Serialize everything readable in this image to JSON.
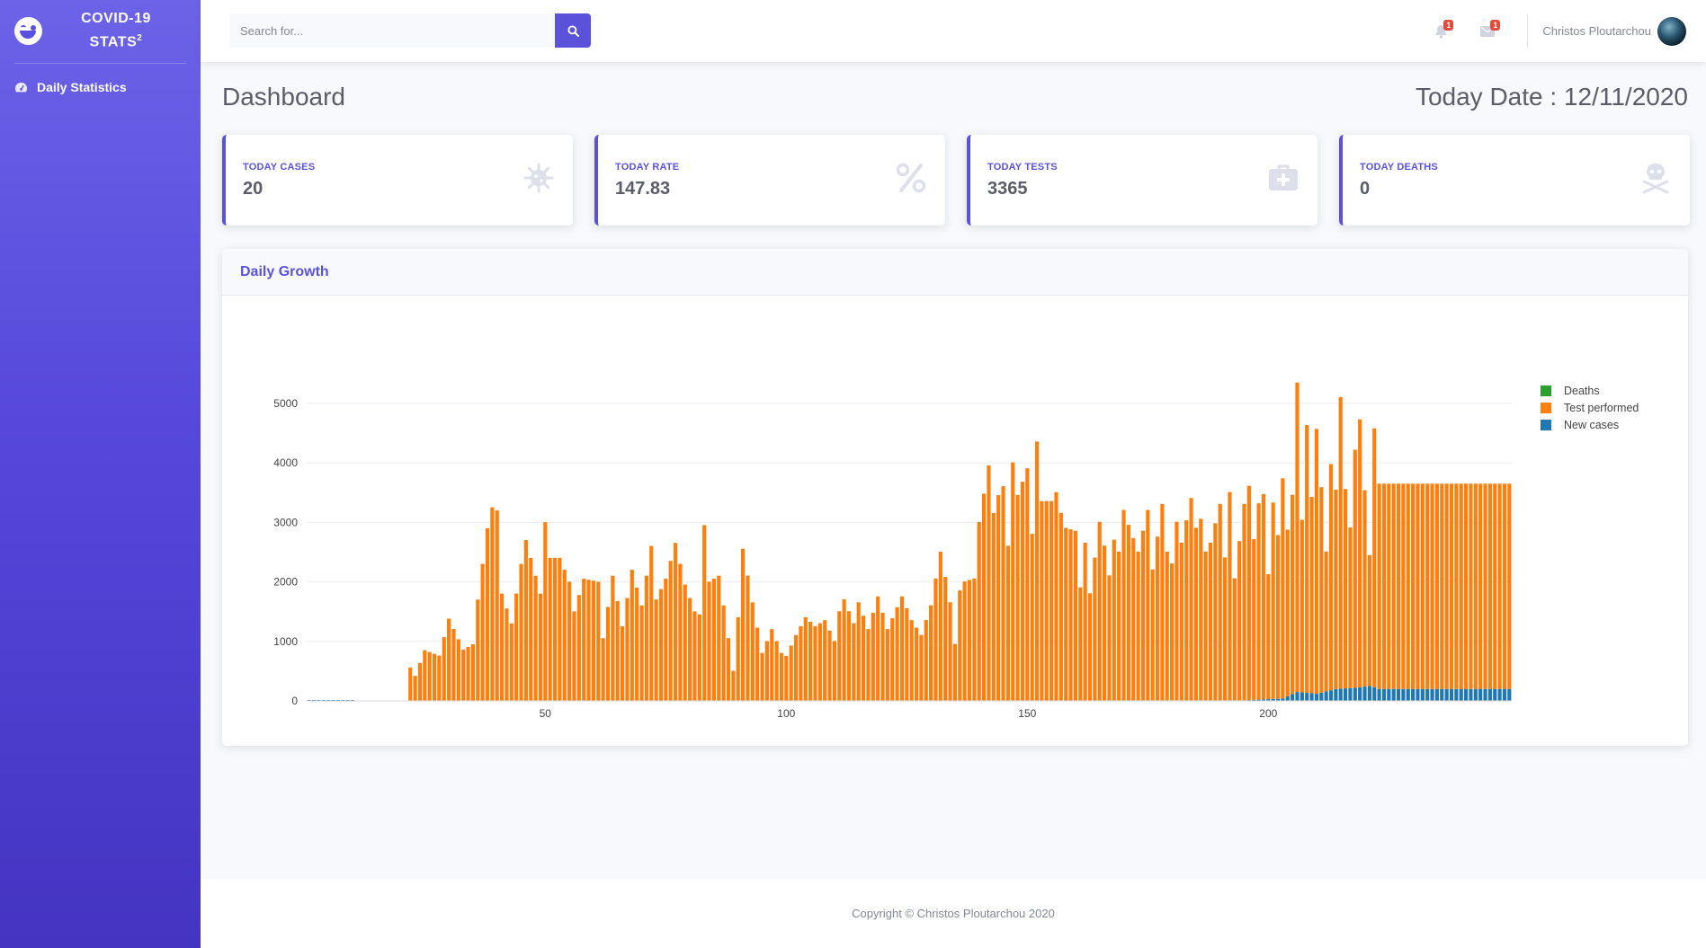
{
  "sidebar": {
    "brand_title": "COVID-19",
    "brand_subtitle": "STATS",
    "brand_sup": "2",
    "nav": [
      {
        "label": "Daily Statistics",
        "icon": "tachometer-icon"
      }
    ]
  },
  "topbar": {
    "search_placeholder": "Search for...",
    "alerts_count": "1",
    "messages_count": "1",
    "user_name": "Christos Ploutarchou"
  },
  "page": {
    "title": "Dashboard",
    "today_date": "Today Date : 12/11/2020"
  },
  "cards": [
    {
      "label": "TODAY CASES",
      "value": "20",
      "icon": "virus-icon"
    },
    {
      "label": "TODAY RATE",
      "value": "147.83",
      "icon": "percent-icon"
    },
    {
      "label": "TODAY TESTS",
      "value": "3365",
      "icon": "medkit-icon"
    },
    {
      "label": "TODAY DEATHS",
      "value": "0",
      "icon": "skull-crossbones-icon"
    }
  ],
  "chart_card": {
    "title": "Daily Growth"
  },
  "chart_data": {
    "type": "bar",
    "stacked": true,
    "x_range": [
      1,
      250
    ],
    "x_ticks": [
      50,
      100,
      150,
      200
    ],
    "y_ticks": [
      0,
      1000,
      2000,
      3000,
      4000,
      5000
    ],
    "ylim": [
      0,
      5300
    ],
    "grid": true,
    "legend_position": "right",
    "colors": {
      "Deaths": "#2ca02c",
      "Test performed": "#ff7f0e",
      "New cases": "#1f77b4"
    },
    "series": [
      {
        "name": "Deaths",
        "values": []
      },
      {
        "name": "Test performed",
        "values": []
      },
      {
        "name": "New cases",
        "values": []
      }
    ],
    "tests_performed_anchor_points": [
      [
        1,
        0
      ],
      [
        21,
        0
      ],
      [
        22,
        560
      ],
      [
        23,
        420
      ],
      [
        25,
        850
      ],
      [
        28,
        760
      ],
      [
        30,
        1380
      ],
      [
        33,
        860
      ],
      [
        35,
        950
      ],
      [
        36,
        1700
      ],
      [
        37,
        2300
      ],
      [
        38,
        2900
      ],
      [
        39,
        3250
      ],
      [
        40,
        3200
      ],
      [
        41,
        1800
      ],
      [
        43,
        1300
      ],
      [
        45,
        2300
      ],
      [
        46,
        2700
      ],
      [
        49,
        1800
      ],
      [
        50,
        3000
      ],
      [
        51,
        2400
      ],
      [
        53,
        2400
      ],
      [
        55,
        2000
      ],
      [
        56,
        1500
      ],
      [
        58,
        2050
      ],
      [
        61,
        2000
      ],
      [
        62,
        1050
      ],
      [
        64,
        2100
      ],
      [
        66,
        1250
      ],
      [
        68,
        2200
      ],
      [
        70,
        1600
      ],
      [
        72,
        2600
      ],
      [
        73,
        1700
      ],
      [
        75,
        2050
      ],
      [
        77,
        2650
      ],
      [
        79,
        1950
      ],
      [
        81,
        1500
      ],
      [
        82,
        1450
      ],
      [
        83,
        2950
      ],
      [
        84,
        2000
      ],
      [
        86,
        2100
      ],
      [
        87,
        1600
      ],
      [
        89,
        500
      ],
      [
        90,
        1400
      ],
      [
        91,
        2550
      ],
      [
        93,
        1650
      ],
      [
        95,
        800
      ],
      [
        97,
        1200
      ],
      [
        99,
        800
      ],
      [
        100,
        750
      ],
      [
        102,
        1100
      ],
      [
        104,
        1400
      ],
      [
        106,
        1250
      ],
      [
        108,
        1350
      ],
      [
        110,
        1000
      ],
      [
        111,
        1500
      ],
      [
        112,
        1700
      ],
      [
        114,
        1300
      ],
      [
        115,
        1650
      ],
      [
        117,
        1200
      ],
      [
        119,
        1750
      ],
      [
        121,
        1200
      ],
      [
        124,
        1750
      ],
      [
        126,
        1350
      ],
      [
        128,
        1100
      ],
      [
        130,
        1600
      ],
      [
        132,
        2500
      ],
      [
        134,
        1650
      ],
      [
        135,
        950
      ],
      [
        136,
        1850
      ],
      [
        137,
        2000
      ],
      [
        139,
        2050
      ],
      [
        140,
        3000
      ],
      [
        142,
        3950
      ],
      [
        143,
        3150
      ],
      [
        144,
        3450
      ],
      [
        145,
        3600
      ],
      [
        146,
        2600
      ],
      [
        147,
        4000
      ],
      [
        148,
        3450
      ],
      [
        150,
        3900
      ],
      [
        151,
        2800
      ],
      [
        152,
        4350
      ],
      [
        153,
        3350
      ],
      [
        155,
        3350
      ],
      [
        156,
        3500
      ],
      [
        157,
        3150
      ],
      [
        158,
        2900
      ],
      [
        160,
        2850
      ],
      [
        161,
        1900
      ],
      [
        162,
        2650
      ],
      [
        163,
        1800
      ],
      [
        165,
        3000
      ],
      [
        166,
        2600
      ],
      [
        167,
        2100
      ],
      [
        168,
        2700
      ],
      [
        169,
        2500
      ],
      [
        170,
        3200
      ],
      [
        171,
        2950
      ],
      [
        173,
        2500
      ],
      [
        175,
        3200
      ],
      [
        176,
        2200
      ],
      [
        178,
        3300
      ],
      [
        179,
        2500
      ],
      [
        180,
        2300
      ],
      [
        181,
        3000
      ],
      [
        182,
        2650
      ],
      [
        184,
        3400
      ],
      [
        185,
        2900
      ],
      [
        186,
        3050
      ],
      [
        187,
        2500
      ],
      [
        188,
        2650
      ],
      [
        190,
        3300
      ],
      [
        191,
        2400
      ],
      [
        192,
        3500
      ],
      [
        193,
        2050
      ],
      [
        195,
        3300
      ],
      [
        196,
        3600
      ],
      [
        197,
        2700
      ],
      [
        198,
        3300
      ],
      [
        199,
        3450
      ],
      [
        200,
        2100
      ],
      [
        201,
        3300
      ],
      [
        202,
        2750
      ],
      [
        203,
        3700
      ],
      [
        204,
        2800
      ],
      [
        205,
        3350
      ],
      [
        206,
        5200
      ],
      [
        207,
        2900
      ],
      [
        208,
        4500
      ],
      [
        209,
        3300
      ],
      [
        210,
        4450
      ],
      [
        211,
        3450
      ],
      [
        212,
        2350
      ],
      [
        213,
        3800
      ],
      [
        214,
        3350
      ],
      [
        215,
        4900
      ],
      [
        216,
        3350
      ],
      [
        217,
        2700
      ],
      [
        218,
        4000
      ],
      [
        219,
        4500
      ],
      [
        220,
        3300
      ],
      [
        221,
        2200
      ],
      [
        222,
        4350
      ],
      [
        223,
        3450
      ],
      [
        250,
        3450
      ]
    ],
    "new_cases_anchor_points": [
      [
        1,
        0
      ],
      [
        195,
        10
      ],
      [
        203,
        40
      ],
      [
        206,
        150
      ],
      [
        210,
        120
      ],
      [
        214,
        200
      ],
      [
        218,
        220
      ],
      [
        221,
        250
      ],
      [
        222,
        230
      ],
      [
        223,
        200
      ],
      [
        250,
        200
      ]
    ],
    "deaths_value_range": [
      0,
      10
    ]
  }
}
